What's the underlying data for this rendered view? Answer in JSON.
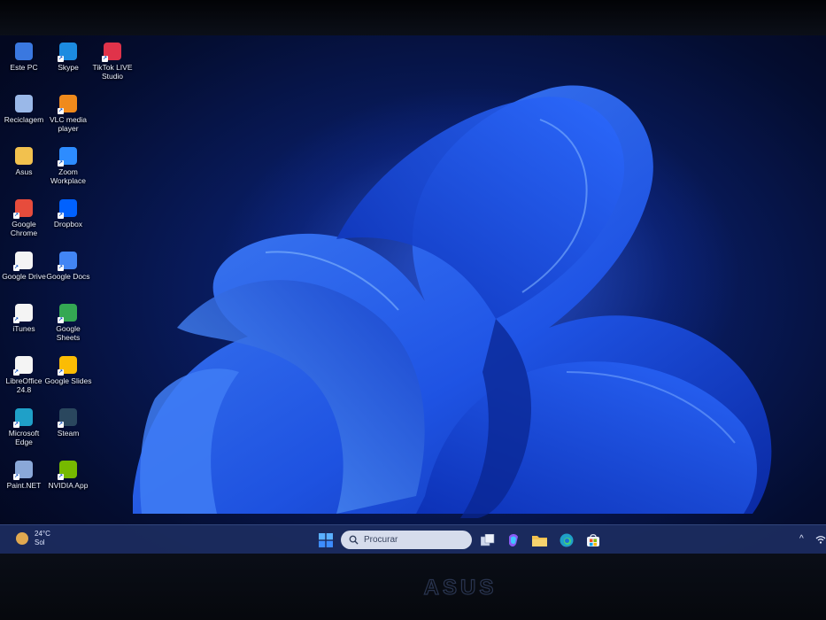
{
  "desktop": {
    "icons": [
      {
        "label": "Este PC",
        "icon": "monitor-icon",
        "color": "#3a78e0"
      },
      {
        "label": "Skype",
        "icon": "skype-icon",
        "color": "#1c8be0"
      },
      {
        "label": "TikTok LIVE Studio",
        "icon": "tiktok-live-icon",
        "color": "#e0334a"
      },
      {
        "label": "Reciclagem",
        "icon": "recycle-bin-icon",
        "color": "#9ab8e8"
      },
      {
        "label": "VLC media player",
        "icon": "vlc-cone-icon",
        "color": "#f08a1c"
      },
      {
        "label": "",
        "icon": "",
        "color": ""
      },
      {
        "label": "Asus",
        "icon": "folder-icon",
        "color": "#f2c14e"
      },
      {
        "label": "Zoom Workplace",
        "icon": "zoom-icon",
        "color": "#2d8cff"
      },
      {
        "label": "",
        "icon": "",
        "color": ""
      },
      {
        "label": "Google Chrome",
        "icon": "chrome-icon",
        "color": "#e74c3c"
      },
      {
        "label": "Dropbox",
        "icon": "dropbox-icon",
        "color": "#0061fe"
      },
      {
        "label": "",
        "icon": "",
        "color": ""
      },
      {
        "label": "Google Drive",
        "icon": "google-drive-icon",
        "color": "#f4f4f4"
      },
      {
        "label": "Google Docs",
        "icon": "google-docs-icon",
        "color": "#4285f4"
      },
      {
        "label": "",
        "icon": "",
        "color": ""
      },
      {
        "label": "iTunes",
        "icon": "itunes-icon",
        "color": "#f4f4f4"
      },
      {
        "label": "Google Sheets",
        "icon": "google-sheets-icon",
        "color": "#34a853"
      },
      {
        "label": "",
        "icon": "",
        "color": ""
      },
      {
        "label": "LibreOffice 24.8",
        "icon": "libreoffice-icon",
        "color": "#f4f4f4"
      },
      {
        "label": "Google Slides",
        "icon": "google-slides-icon",
        "color": "#fbbc04"
      },
      {
        "label": "",
        "icon": "",
        "color": ""
      },
      {
        "label": "Microsoft Edge",
        "icon": "edge-icon",
        "color": "#1fa0c8"
      },
      {
        "label": "Steam",
        "icon": "steam-icon",
        "color": "#2a475e"
      },
      {
        "label": "",
        "icon": "",
        "color": ""
      },
      {
        "label": "Paint.NET",
        "icon": "paintnet-icon",
        "color": "#8aa8d8"
      },
      {
        "label": "NVIDIA App",
        "icon": "nvidia-icon",
        "color": "#76b900"
      }
    ]
  },
  "taskbar": {
    "weather": {
      "temp": "24°C",
      "condition": "Sol"
    },
    "search_placeholder": "Procurar",
    "chevron": "^"
  },
  "brand": "ASUS",
  "colors": {
    "accent": "#1f5cff",
    "taskbar": "#1c2d5f"
  }
}
